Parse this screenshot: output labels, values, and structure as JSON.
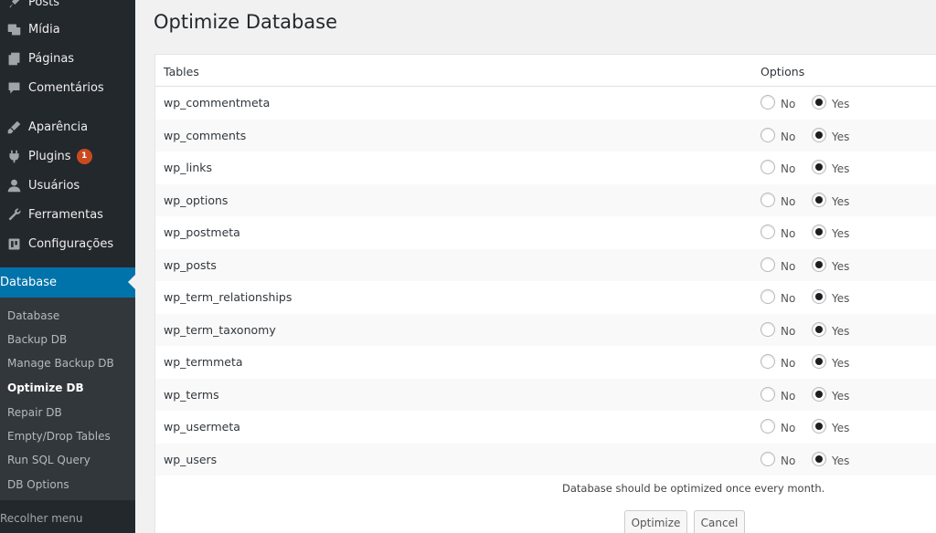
{
  "sidebar": {
    "menu": [
      {
        "label": "Posts",
        "icon": "pin-icon"
      },
      {
        "label": "Mídia",
        "icon": "media-icon"
      },
      {
        "label": "Páginas",
        "icon": "pages-icon"
      },
      {
        "label": "Comentários",
        "icon": "comments-icon"
      },
      {
        "label": "Aparência",
        "icon": "brush-icon"
      },
      {
        "label": "Plugins",
        "icon": "plug-icon",
        "badge": "1"
      },
      {
        "label": "Usuários",
        "icon": "user-icon"
      },
      {
        "label": "Ferramentas",
        "icon": "wrench-icon"
      },
      {
        "label": "Configurações",
        "icon": "settings-icon"
      }
    ],
    "current": {
      "label": "Database",
      "icon": "database-icon"
    },
    "submenu": [
      "Database",
      "Backup DB",
      "Manage Backup DB",
      "Optimize DB",
      "Repair DB",
      "Empty/Drop Tables",
      "Run SQL Query",
      "DB Options"
    ],
    "submenu_current": "Optimize DB",
    "collapse_label": "Recolher menu"
  },
  "main": {
    "title": "Optimize Database",
    "headers": {
      "tables": "Tables",
      "options": "Options"
    },
    "option_labels": {
      "no": "No",
      "yes": "Yes"
    },
    "rows": [
      {
        "table": "wp_commentmeta",
        "selected": "yes"
      },
      {
        "table": "wp_comments",
        "selected": "yes"
      },
      {
        "table": "wp_links",
        "selected": "yes"
      },
      {
        "table": "wp_options",
        "selected": "yes"
      },
      {
        "table": "wp_postmeta",
        "selected": "yes"
      },
      {
        "table": "wp_posts",
        "selected": "yes"
      },
      {
        "table": "wp_term_relationships",
        "selected": "yes"
      },
      {
        "table": "wp_term_taxonomy",
        "selected": "yes"
      },
      {
        "table": "wp_termmeta",
        "selected": "yes"
      },
      {
        "table": "wp_terms",
        "selected": "yes"
      },
      {
        "table": "wp_usermeta",
        "selected": "yes"
      },
      {
        "table": "wp_users",
        "selected": "yes"
      }
    ],
    "note": "Database should be optimized once every month.",
    "optimize_label": "Optimize",
    "cancel_label": "Cancel"
  },
  "colors": {
    "sidebar_bg": "#23282d",
    "submenu_bg": "#32373c",
    "accent": "#0073aa",
    "badge": "#ca4a1f"
  }
}
